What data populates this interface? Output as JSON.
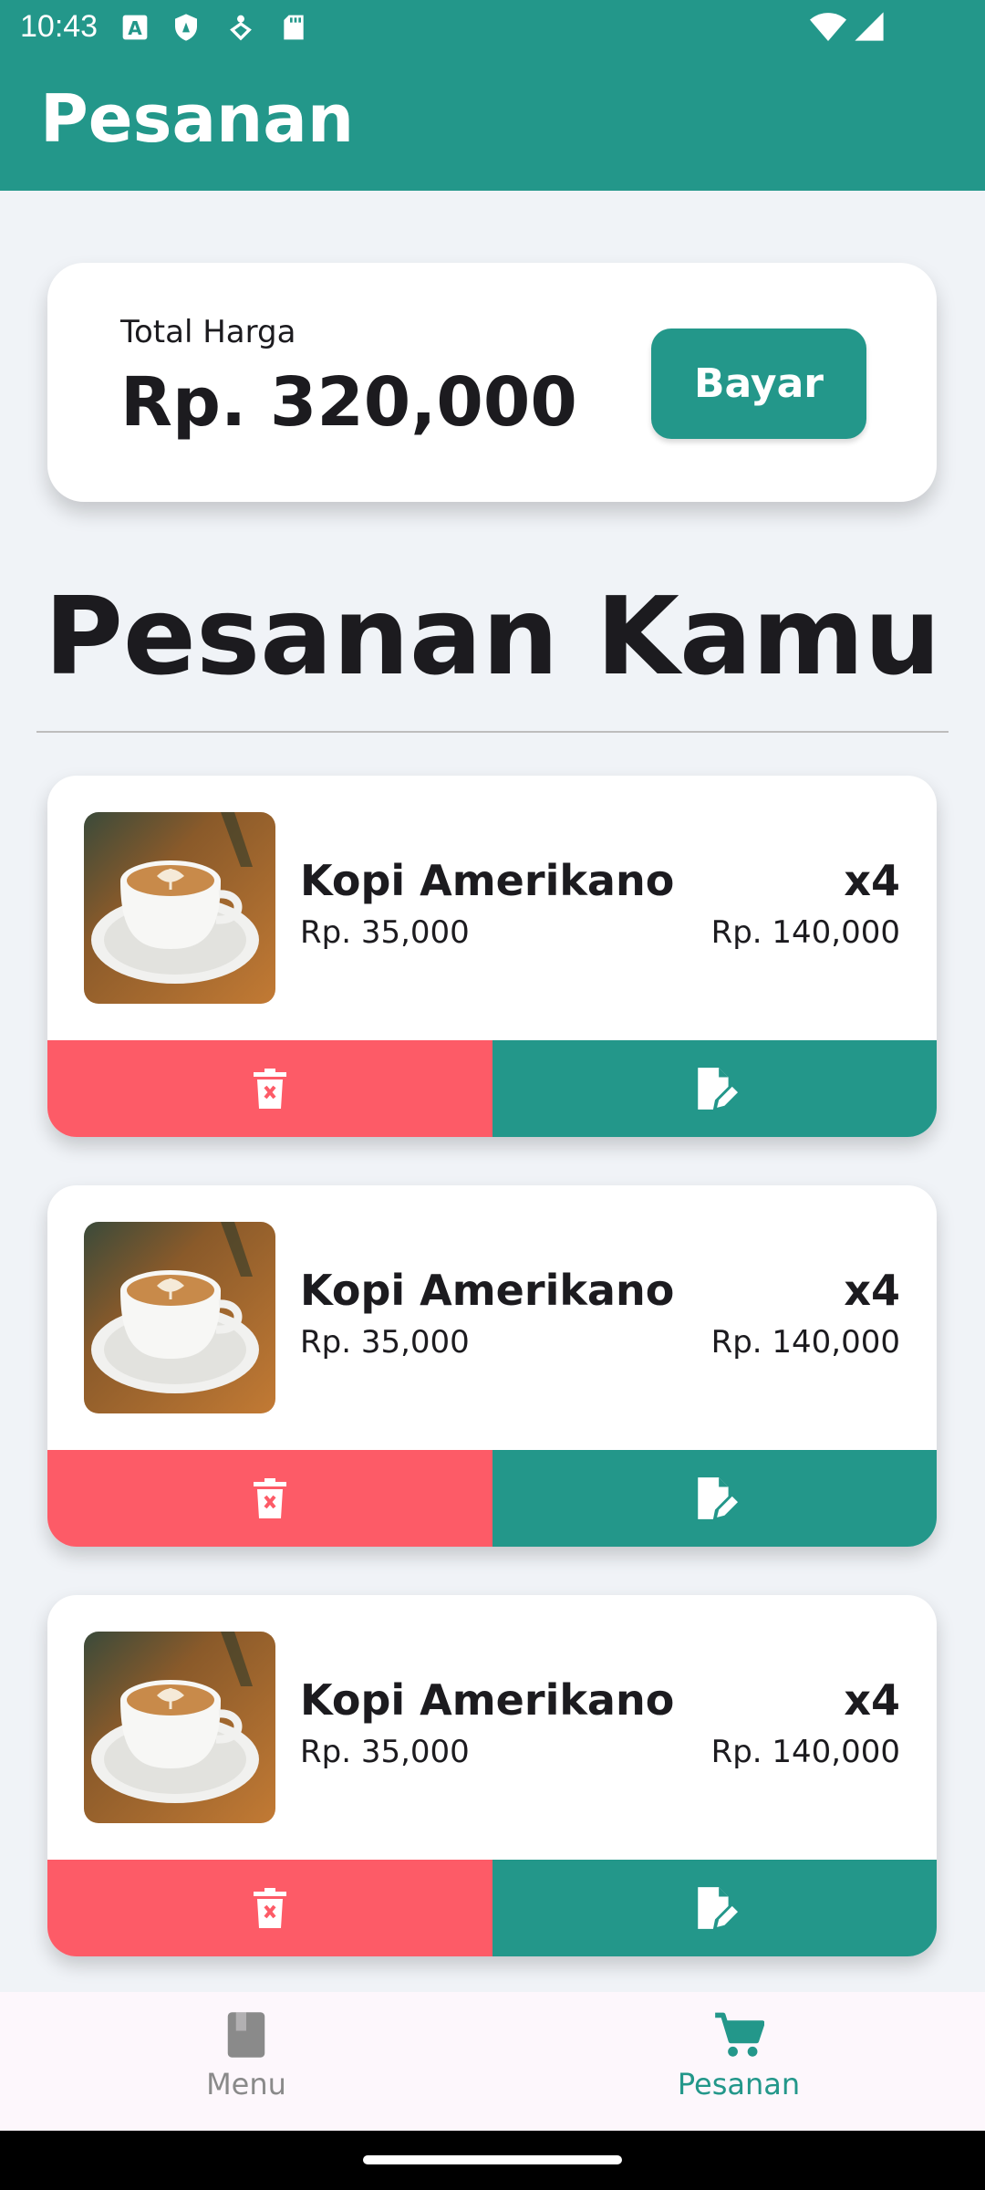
{
  "status_bar": {
    "time": "10:43",
    "left_icons": [
      "a-box-icon",
      "shield-icon",
      "data-saver-icon",
      "sd-card-icon"
    ],
    "right_icons": [
      "wifi-icon",
      "signal-icon"
    ]
  },
  "app_bar": {
    "title": "Pesanan"
  },
  "total": {
    "label": "Total Harga",
    "value": "Rp. 320,000",
    "pay_label": "Bayar"
  },
  "section_title": "Pesanan Kamu",
  "orders": [
    {
      "name": "Kopi Amerikano",
      "price": "Rp. 35,000",
      "qty": "x4",
      "subtotal": "Rp. 140,000"
    },
    {
      "name": "Kopi Amerikano",
      "price": "Rp. 35,000",
      "qty": "x4",
      "subtotal": "Rp. 140,000"
    },
    {
      "name": "Kopi Amerikano",
      "price": "Rp. 35,000",
      "qty": "x4",
      "subtotal": "Rp. 140,000"
    }
  ],
  "bottom_nav": {
    "items": [
      {
        "label": "Menu",
        "icon": "book-icon",
        "active": false
      },
      {
        "label": "Pesanan",
        "icon": "cart-icon",
        "active": true
      }
    ]
  },
  "colors": {
    "primary": "#23978a",
    "delete": "#fd5b67",
    "background": "#f0f3f7"
  }
}
